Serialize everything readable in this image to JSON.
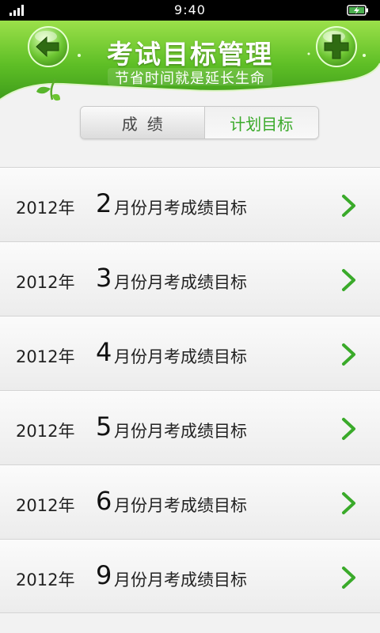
{
  "status_bar": {
    "time": "9:40"
  },
  "header": {
    "title": "考试目标管理",
    "subtitle": "节省时间就是延长生命",
    "back_icon": "arrow-left-icon",
    "add_icon": "plus-icon"
  },
  "tabs": [
    {
      "label": "成绩",
      "selected": false
    },
    {
      "label": "计划目标",
      "selected": true
    }
  ],
  "items": [
    {
      "year": "2012年",
      "month": "2",
      "label": "月份月考成绩目标"
    },
    {
      "year": "2012年",
      "month": "3",
      "label": "月份月考成绩目标"
    },
    {
      "year": "2012年",
      "month": "4",
      "label": "月份月考成绩目标"
    },
    {
      "year": "2012年",
      "month": "5",
      "label": "月份月考成绩目标"
    },
    {
      "year": "2012年",
      "month": "6",
      "label": "月份月考成绩目标"
    },
    {
      "year": "2012年",
      "month": "9",
      "label": "月份月考成绩目标"
    }
  ],
  "colors": {
    "accent_green": "#3aaa2a",
    "header_green": "#6cc531"
  }
}
